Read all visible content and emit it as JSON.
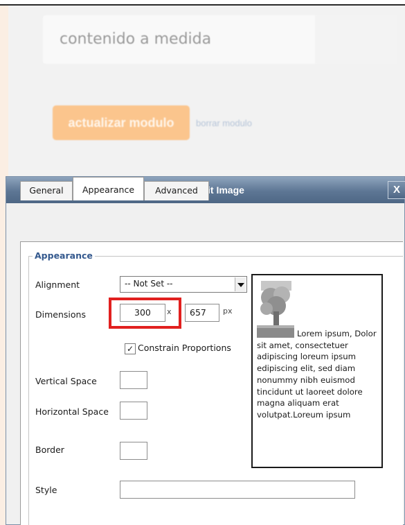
{
  "background": {
    "content_label": "contenido a medida",
    "update_button": "actualizar modulo",
    "delete_link": "borrar modulo"
  },
  "dialog": {
    "title": "Insert/Edit Image",
    "close_label": "X",
    "tabs": [
      {
        "label": "General",
        "active": false
      },
      {
        "label": "Appearance",
        "active": true
      },
      {
        "label": "Advanced",
        "active": false
      }
    ],
    "legend": "Appearance",
    "alignment": {
      "label": "Alignment",
      "value": "-- Not Set --"
    },
    "dimensions": {
      "label": "Dimensions",
      "width": "300",
      "separator": "x",
      "height": "657",
      "unit": "px"
    },
    "constrain": {
      "label": "Constrain Proportions",
      "checked": true,
      "check_mark": "✓"
    },
    "vertical_space": {
      "label": "Vertical Space",
      "value": ""
    },
    "horizontal_space": {
      "label": "Horizontal Space",
      "value": ""
    },
    "border": {
      "label": "Border",
      "value": ""
    },
    "style": {
      "label": "Style",
      "value": ""
    },
    "preview_text": "Lorem ipsum, Dolor sit amet, consectetuer adipiscing loreum ipsum edipiscing elit, sed diam nonummy nibh euismod tincidunt ut laoreet dolore magna aliquam erat volutpat.Loreum ipsum"
  },
  "colors": {
    "dialog_title_bar": "#5d7694",
    "legend_text": "#34598e",
    "highlight_box": "#e1201f",
    "update_button_bg": "#fbc58d"
  },
  "icons": {
    "close": "close-icon",
    "dropdown": "chevron-down-icon",
    "preview": "tree-image-icon"
  }
}
